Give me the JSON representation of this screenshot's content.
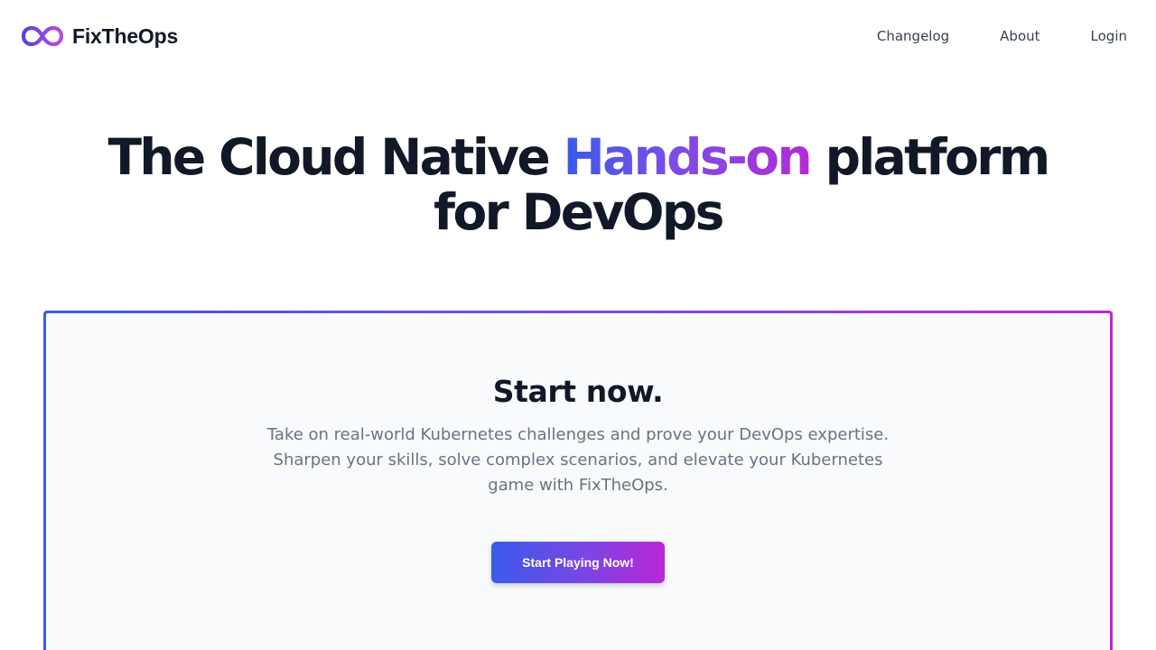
{
  "brand": {
    "name": "FixTheOps",
    "logo_icon": "infinity-icon",
    "gradient": [
      "#3b5bea",
      "#7a4ee3",
      "#c026d3"
    ]
  },
  "nav": {
    "items": [
      {
        "label": "Changelog"
      },
      {
        "label": "About"
      },
      {
        "label": "Login"
      }
    ]
  },
  "hero": {
    "title_prefix": "The Cloud Native ",
    "title_highlight": "Hands-on",
    "title_suffix": " platform",
    "title_line2": "for DevOps"
  },
  "card": {
    "title": "Start now.",
    "description": "Take on real-world Kubernetes challenges and prove your DevOps expertise. Sharpen your skills, solve complex scenarios, and elevate your Kubernetes game with FixTheOps.",
    "cta_label": "Start Playing Now!"
  }
}
